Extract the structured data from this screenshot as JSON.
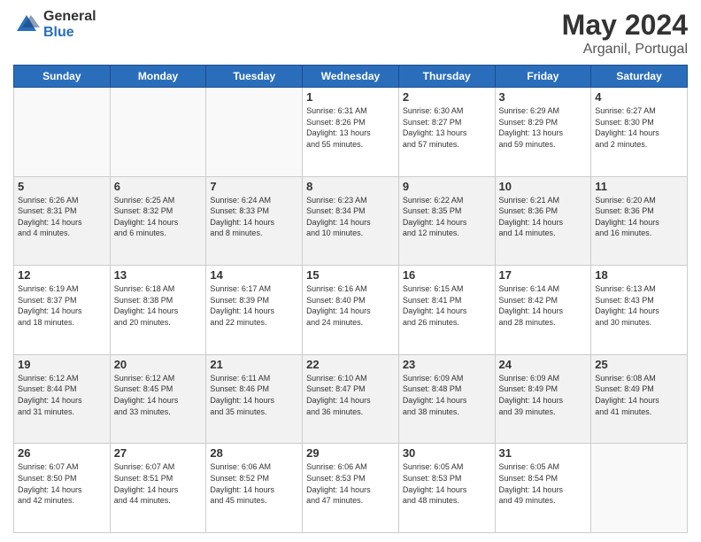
{
  "header": {
    "logo_general": "General",
    "logo_blue": "Blue",
    "title": "May 2024",
    "location": "Arganil, Portugal"
  },
  "weekdays": [
    "Sunday",
    "Monday",
    "Tuesday",
    "Wednesday",
    "Thursday",
    "Friday",
    "Saturday"
  ],
  "weeks": [
    [
      {
        "day": "",
        "info": ""
      },
      {
        "day": "",
        "info": ""
      },
      {
        "day": "",
        "info": ""
      },
      {
        "day": "1",
        "info": "Sunrise: 6:31 AM\nSunset: 8:26 PM\nDaylight: 13 hours\nand 55 minutes."
      },
      {
        "day": "2",
        "info": "Sunrise: 6:30 AM\nSunset: 8:27 PM\nDaylight: 13 hours\nand 57 minutes."
      },
      {
        "day": "3",
        "info": "Sunrise: 6:29 AM\nSunset: 8:29 PM\nDaylight: 13 hours\nand 59 minutes."
      },
      {
        "day": "4",
        "info": "Sunrise: 6:27 AM\nSunset: 8:30 PM\nDaylight: 14 hours\nand 2 minutes."
      }
    ],
    [
      {
        "day": "5",
        "info": "Sunrise: 6:26 AM\nSunset: 8:31 PM\nDaylight: 14 hours\nand 4 minutes."
      },
      {
        "day": "6",
        "info": "Sunrise: 6:25 AM\nSunset: 8:32 PM\nDaylight: 14 hours\nand 6 minutes."
      },
      {
        "day": "7",
        "info": "Sunrise: 6:24 AM\nSunset: 8:33 PM\nDaylight: 14 hours\nand 8 minutes."
      },
      {
        "day": "8",
        "info": "Sunrise: 6:23 AM\nSunset: 8:34 PM\nDaylight: 14 hours\nand 10 minutes."
      },
      {
        "day": "9",
        "info": "Sunrise: 6:22 AM\nSunset: 8:35 PM\nDaylight: 14 hours\nand 12 minutes."
      },
      {
        "day": "10",
        "info": "Sunrise: 6:21 AM\nSunset: 8:36 PM\nDaylight: 14 hours\nand 14 minutes."
      },
      {
        "day": "11",
        "info": "Sunrise: 6:20 AM\nSunset: 8:36 PM\nDaylight: 14 hours\nand 16 minutes."
      }
    ],
    [
      {
        "day": "12",
        "info": "Sunrise: 6:19 AM\nSunset: 8:37 PM\nDaylight: 14 hours\nand 18 minutes."
      },
      {
        "day": "13",
        "info": "Sunrise: 6:18 AM\nSunset: 8:38 PM\nDaylight: 14 hours\nand 20 minutes."
      },
      {
        "day": "14",
        "info": "Sunrise: 6:17 AM\nSunset: 8:39 PM\nDaylight: 14 hours\nand 22 minutes."
      },
      {
        "day": "15",
        "info": "Sunrise: 6:16 AM\nSunset: 8:40 PM\nDaylight: 14 hours\nand 24 minutes."
      },
      {
        "day": "16",
        "info": "Sunrise: 6:15 AM\nSunset: 8:41 PM\nDaylight: 14 hours\nand 26 minutes."
      },
      {
        "day": "17",
        "info": "Sunrise: 6:14 AM\nSunset: 8:42 PM\nDaylight: 14 hours\nand 28 minutes."
      },
      {
        "day": "18",
        "info": "Sunrise: 6:13 AM\nSunset: 8:43 PM\nDaylight: 14 hours\nand 30 minutes."
      }
    ],
    [
      {
        "day": "19",
        "info": "Sunrise: 6:12 AM\nSunset: 8:44 PM\nDaylight: 14 hours\nand 31 minutes."
      },
      {
        "day": "20",
        "info": "Sunrise: 6:12 AM\nSunset: 8:45 PM\nDaylight: 14 hours\nand 33 minutes."
      },
      {
        "day": "21",
        "info": "Sunrise: 6:11 AM\nSunset: 8:46 PM\nDaylight: 14 hours\nand 35 minutes."
      },
      {
        "day": "22",
        "info": "Sunrise: 6:10 AM\nSunset: 8:47 PM\nDaylight: 14 hours\nand 36 minutes."
      },
      {
        "day": "23",
        "info": "Sunrise: 6:09 AM\nSunset: 8:48 PM\nDaylight: 14 hours\nand 38 minutes."
      },
      {
        "day": "24",
        "info": "Sunrise: 6:09 AM\nSunset: 8:49 PM\nDaylight: 14 hours\nand 39 minutes."
      },
      {
        "day": "25",
        "info": "Sunrise: 6:08 AM\nSunset: 8:49 PM\nDaylight: 14 hours\nand 41 minutes."
      }
    ],
    [
      {
        "day": "26",
        "info": "Sunrise: 6:07 AM\nSunset: 8:50 PM\nDaylight: 14 hours\nand 42 minutes."
      },
      {
        "day": "27",
        "info": "Sunrise: 6:07 AM\nSunset: 8:51 PM\nDaylight: 14 hours\nand 44 minutes."
      },
      {
        "day": "28",
        "info": "Sunrise: 6:06 AM\nSunset: 8:52 PM\nDaylight: 14 hours\nand 45 minutes."
      },
      {
        "day": "29",
        "info": "Sunrise: 6:06 AM\nSunset: 8:53 PM\nDaylight: 14 hours\nand 47 minutes."
      },
      {
        "day": "30",
        "info": "Sunrise: 6:05 AM\nSunset: 8:53 PM\nDaylight: 14 hours\nand 48 minutes."
      },
      {
        "day": "31",
        "info": "Sunrise: 6:05 AM\nSunset: 8:54 PM\nDaylight: 14 hours\nand 49 minutes."
      },
      {
        "day": "",
        "info": ""
      }
    ]
  ]
}
